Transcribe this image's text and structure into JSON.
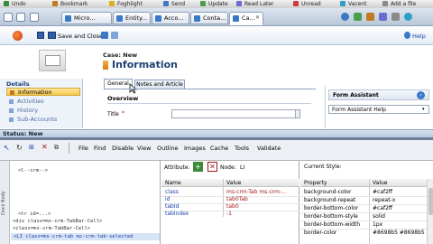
{
  "browser_toolbar": {
    "items": [
      "Undo",
      "Bookmark",
      "Foghlight",
      "Send",
      "Update",
      "Read Later",
      "Unread",
      "Vacent",
      "Add a file"
    ]
  },
  "tabs": [
    "Micro...",
    "Entity...",
    "Acco...",
    "Conta...",
    "Ca..."
  ],
  "app_toolbar": {
    "save_close": "Save and Close",
    "help": "Help"
  },
  "header": {
    "entity_label": "Case: New",
    "title": "Information"
  },
  "left_nav": {
    "heading": "Details",
    "items": [
      "Information",
      "Activities",
      "History",
      "Sub-Accounts",
      "..."
    ]
  },
  "form": {
    "tabs": [
      "General",
      "Notes and Article"
    ],
    "section": "Overview",
    "field_label": "Title",
    "required_mark": "*",
    "form_assistant": "Form Assistant",
    "form_assistant_select": "Form Assistant Help"
  },
  "status": {
    "text": "Status: New"
  },
  "devtools": {
    "menu": [
      "File",
      "Find",
      "Disable",
      "View",
      "Outline",
      "Images",
      "Cache",
      "Tools",
      "Validate"
    ],
    "tree_lines": [
      "<l--crm-->",
      "<l--crm-->",
      "</div>",
      "<tr id=...>",
      "<div class=ms-crm-TabBar-Cell>",
      "<class=ms-crm-TabBar-Cell>",
      "<LI class=ms-crm-tab ms-crm-tab-selected"
    ],
    "side_label": "Dock Body",
    "attributes": {
      "label": "Attribute:",
      "node_label": "Node:",
      "node_value": "LI",
      "col_attr": "Name",
      "col_value": "Value",
      "rows": [
        {
          "name": "class",
          "value": "ms-crm-Tab ms-crm-..."
        },
        {
          "name": "id",
          "value": "tab0Tab"
        },
        {
          "name": "tabId",
          "value": "tab0"
        },
        {
          "name": "tabIndex",
          "value": "-1"
        }
      ]
    },
    "styles": {
      "heading": "Current Style:",
      "col_prop": "Property",
      "col_value": "Value",
      "rows": [
        {
          "name": "background-color",
          "value": "#caf2ff"
        },
        {
          "name": "background-repeat",
          "value": "repeat-x"
        },
        {
          "name": "border-bottom-color",
          "value": "#caf2ff"
        },
        {
          "name": "border-bottom-style",
          "value": "solid"
        },
        {
          "name": "border-bottom-width",
          "value": "1px"
        },
        {
          "name": "border-color",
          "value": "#8698b5 #8698b5"
        }
      ]
    }
  }
}
